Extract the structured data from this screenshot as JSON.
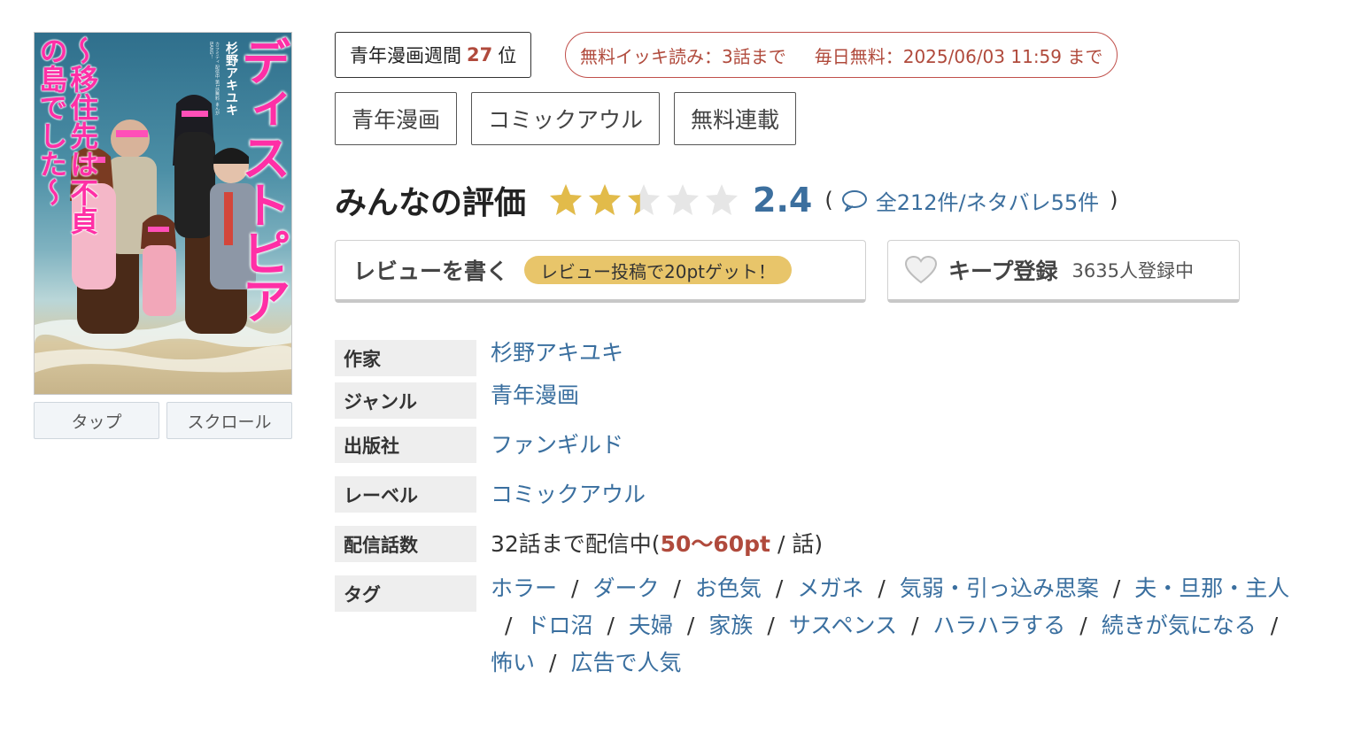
{
  "cover": {
    "title": "ディストピア",
    "subtitle": "～移住先は不貞の島でした～",
    "author": "杉野アキユキ",
    "small_text": "カラミティ 配信中 第1話無料 まんがBANG！",
    "buttons": [
      "タップ",
      "スクロール"
    ]
  },
  "ranking": {
    "category": "青年漫画週間",
    "rank": "27",
    "suffix": "位"
  },
  "free_info": {
    "ikki": "無料イッキ読み：3話まで",
    "daily": "毎日無料：2025/06/03 11:59 まで"
  },
  "genre_tags": [
    "青年漫画",
    "コミックアウル",
    "無料連載"
  ],
  "rating": {
    "title": "みんなの評価",
    "score": "2.4",
    "stars_value": 2.4,
    "stars_max": 5,
    "open_paren": "(",
    "review_count": "全212件/ネタバレ55件",
    "close_paren": ")"
  },
  "review_button": {
    "label": "レビューを書く",
    "bonus": "レビュー投稿で20ptゲット！"
  },
  "keep_button": {
    "label": "キープ登録",
    "count": "3635人登録中"
  },
  "info": {
    "author_key": "作家",
    "author_val": "杉野アキユキ",
    "genre_key": "ジャンル",
    "genre_val": "青年漫画",
    "publisher_key": "出版社",
    "publisher_val": "ファンギルド",
    "label_key": "レーベル",
    "label_val": "コミックアウル",
    "episodes_key": "配信話数",
    "episodes_prefix": "32話まで配信中(",
    "episodes_price": "50〜60pt",
    "episodes_suffix": " / 話)",
    "tags_key": "タグ",
    "tags": [
      "ホラー",
      "ダーク",
      "お色気",
      "メガネ",
      "気弱・引っ込み思案",
      "夫・旦那・主人",
      "ドロ沼",
      "夫婦",
      "家族",
      "サスペンス",
      "ハラハラする",
      "続きが気になる",
      "怖い",
      "広告で人気"
    ],
    "separator": "/"
  },
  "colors": {
    "link": "#3a6f9f",
    "accent_red": "#b04a3c",
    "star_gold": "#e2bb4a",
    "star_gray": "#e6e6e6",
    "bonus_yellow": "#e8c56a"
  }
}
